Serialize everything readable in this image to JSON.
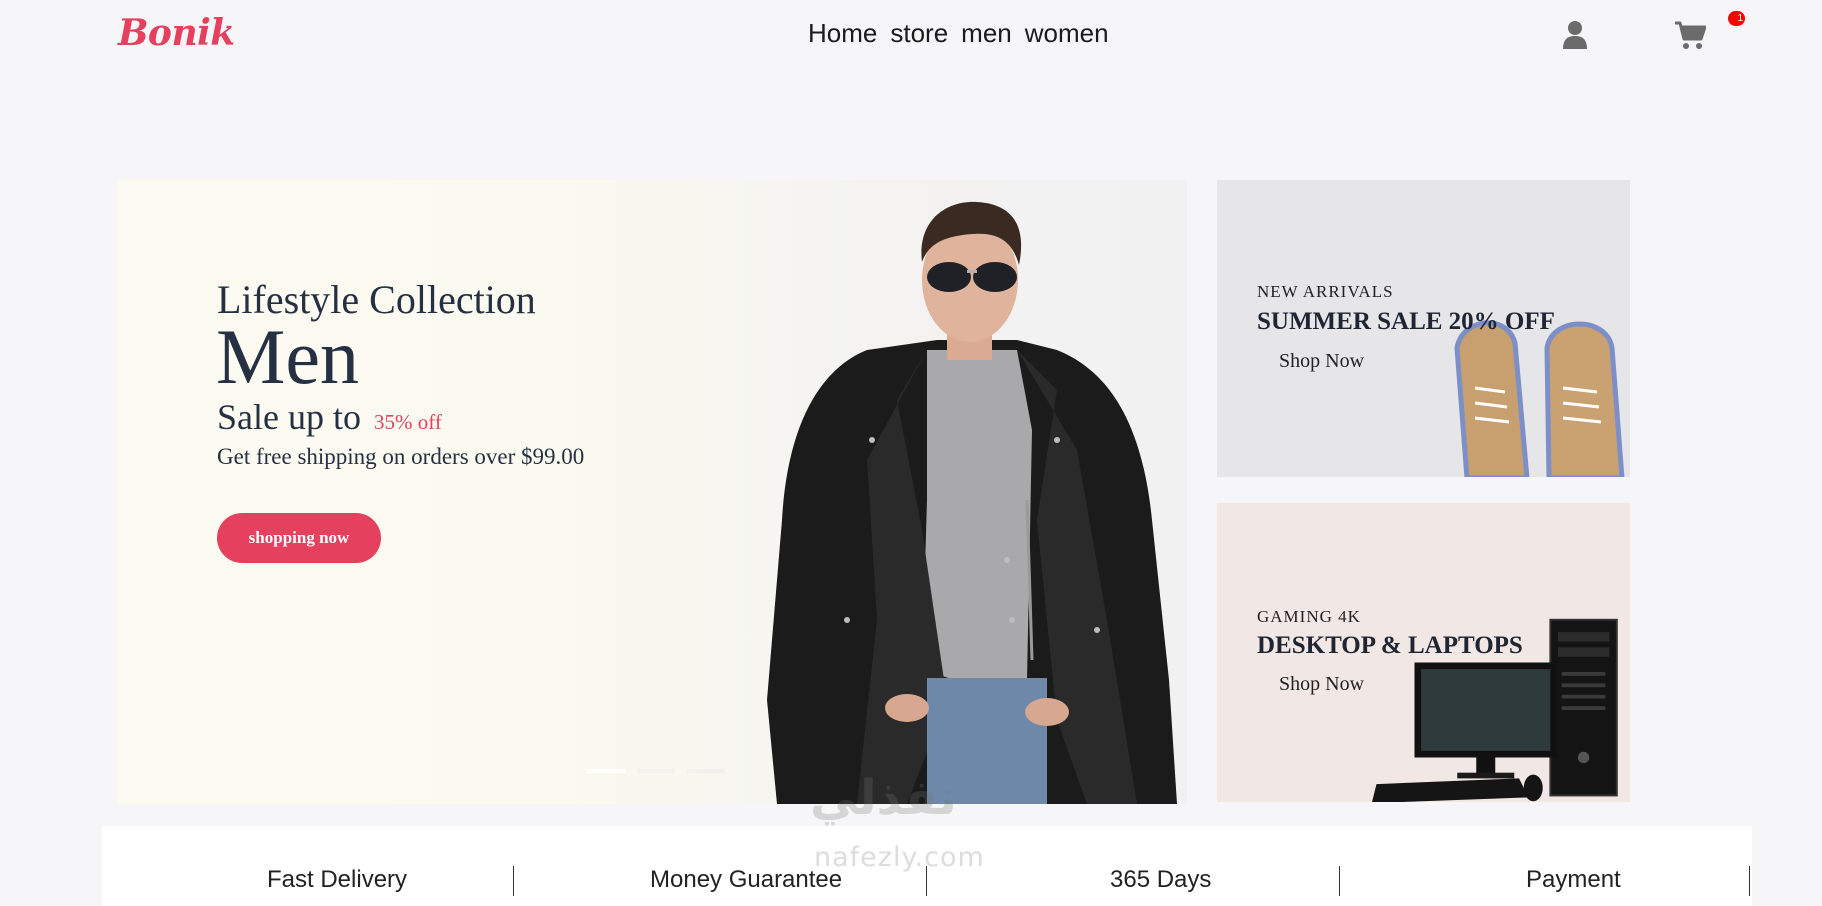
{
  "header": {
    "logo": "Bonik",
    "nav": [
      "Home",
      "store",
      "men",
      "women"
    ],
    "cart_count": "1"
  },
  "hero": {
    "subtitle": "Lifestyle Collection",
    "title": "Men",
    "sale_text": "Sale up to",
    "sale_off": "35% off",
    "shipping": "Get free shipping on orders over $99.00",
    "button": "shopping now",
    "active_slide": 1,
    "slide_count": 3
  },
  "promos": [
    {
      "kicker": "NEW ARRIVALS",
      "headline": "SUMMER SALE 20% OFF",
      "cta": "Shop Now"
    },
    {
      "kicker": "GAMING 4K",
      "headline": "DESKTOP & LAPTOPS",
      "cta": "Shop Now"
    }
  ],
  "features": [
    "Fast Delivery",
    "Money Guarantee",
    "365 Days",
    "Payment"
  ],
  "watermark": {
    "arabic": "نفذلي",
    "latin": "nafezly.com"
  },
  "colors": {
    "accent": "#e5405e",
    "background": "#f6f5f7",
    "text": "#253042",
    "badge": "#ff0000"
  }
}
